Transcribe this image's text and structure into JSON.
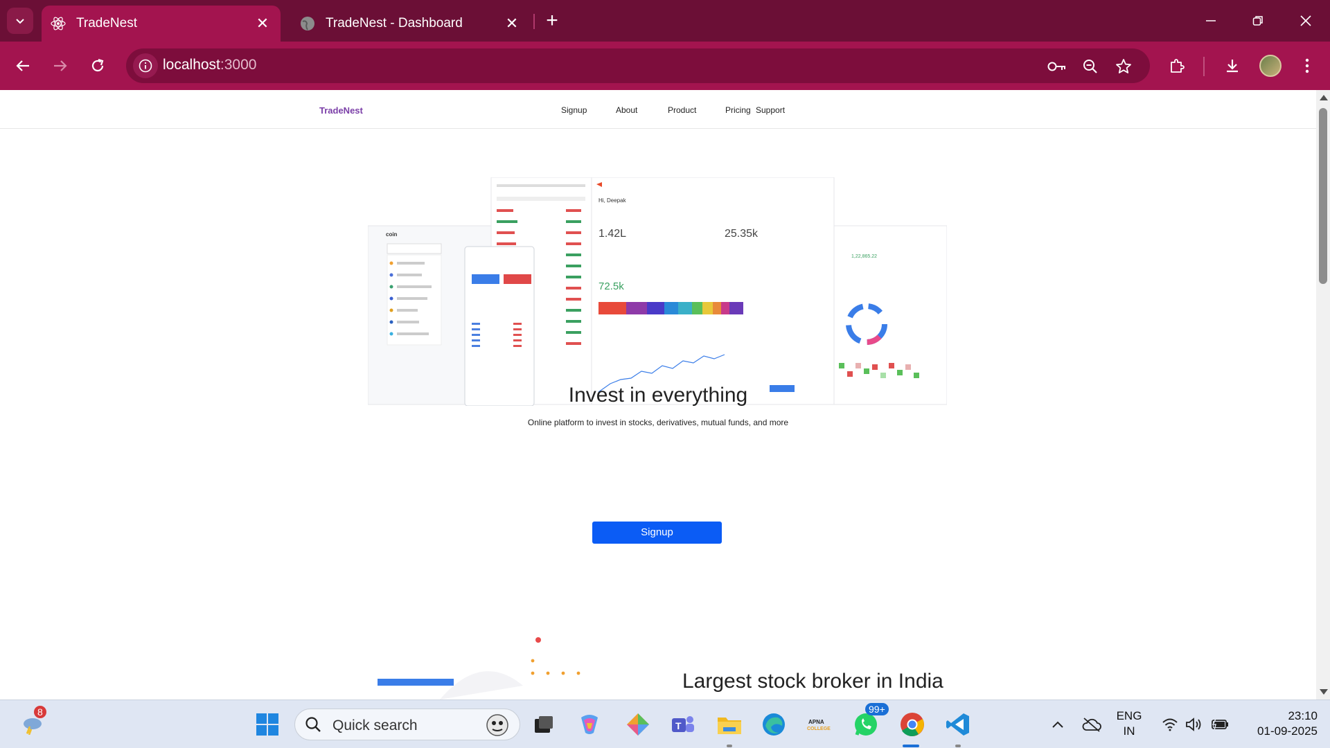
{
  "browser": {
    "tabs": [
      {
        "title": "TradeNest",
        "active": true
      },
      {
        "title": "TradeNest - Dashboard",
        "active": false
      }
    ],
    "url_host": "localhost",
    "url_port": ":3000"
  },
  "navbar": {
    "logo": "TradeNest",
    "links": [
      "Signup",
      "About",
      "Product",
      "Pricing",
      "Support"
    ]
  },
  "hero": {
    "dashboard_greeting": "Hi, Deepak",
    "equity_value": "1.42L",
    "commodity_value": "25.35k",
    "holdings_value": "72.5k",
    "title": "Invest in everything",
    "subtitle": "Online platform to invest in stocks, derivatives, mutual funds, and more",
    "signup_label": "Signup"
  },
  "section2": {
    "title": "Largest stock broker in India"
  },
  "taskbar": {
    "weather_badge": "8",
    "search_placeholder": "Quick search",
    "whatsapp_badge": "99+",
    "language_line1": "ENG",
    "language_line2": "IN",
    "time": "23:10",
    "date": "01-09-2025"
  },
  "colors": {
    "tabstrip": "#6b0f36",
    "toolbar": "#a3144f",
    "primary_button": "#0b5cf5",
    "logo": "#7b3fa8"
  }
}
